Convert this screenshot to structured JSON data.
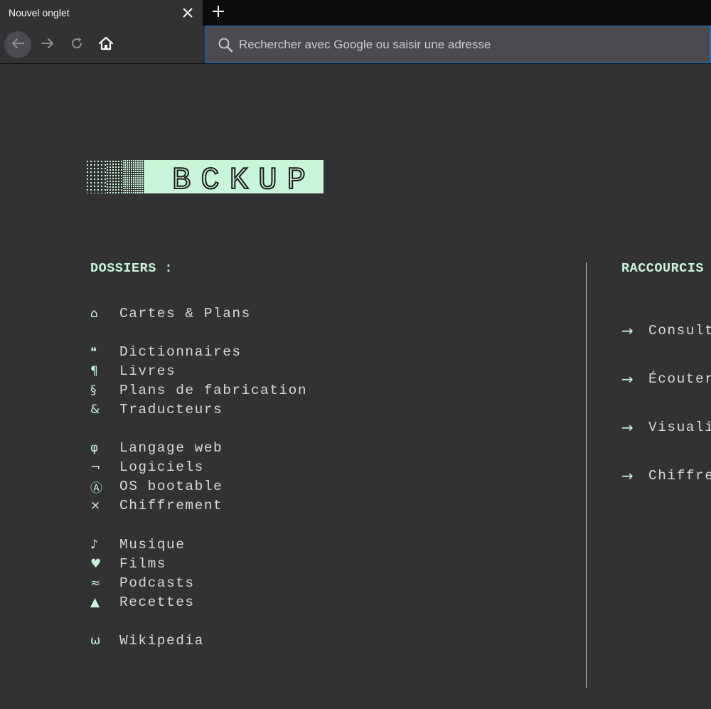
{
  "browser": {
    "tab": {
      "title": "Nouvel onglet"
    },
    "urlbar": {
      "placeholder": "Rechercher avec Google ou saisir une adresse",
      "value": ""
    },
    "icons": [
      "back-icon",
      "forward-icon",
      "reload-icon",
      "home-icon",
      "search-icon",
      "close-icon",
      "plus-icon"
    ]
  },
  "logo": {
    "text": "BCKUP",
    "background": "#c9f5da",
    "ink": "#1a1a1a"
  },
  "dossiers": {
    "title": "DOSSIERS :",
    "items": [
      {
        "icon": "⌂",
        "label": "Cartes & Plans"
      },
      {
        "icon": "❝",
        "label": "Dictionnaires"
      },
      {
        "icon": "¶",
        "label": "Livres"
      },
      {
        "icon": "§",
        "label": "Plans de fabrication"
      },
      {
        "icon": "&",
        "label": "Traducteurs"
      },
      {
        "icon": "φ",
        "label": "Langage web"
      },
      {
        "icon": "¬",
        "label": "Logiciels"
      },
      {
        "icon": "Ⓐ",
        "label": "OS bootable"
      },
      {
        "icon": "×",
        "label": "Chiffrement"
      },
      {
        "icon": "♪",
        "label": "Musique"
      },
      {
        "icon": "♥",
        "label": "Films"
      },
      {
        "icon": "≈",
        "label": "Podcasts"
      },
      {
        "icon": "▲",
        "label": "Recettes"
      },
      {
        "icon": "ω",
        "label": "Wikipedia"
      }
    ]
  },
  "raccourcis": {
    "title": "RACCOURCIS",
    "items": [
      {
        "arrow": "→",
        "label": "Consult"
      },
      {
        "arrow": "→",
        "label": "Écouter"
      },
      {
        "arrow": "→",
        "label": "Visuali"
      },
      {
        "arrow": "→",
        "label": "Chiffre"
      }
    ]
  },
  "colors": {
    "background": "#323234",
    "accent": "#c9f5da",
    "text": "#d8d8d8",
    "urlbar_focus": "#0a84ff"
  }
}
